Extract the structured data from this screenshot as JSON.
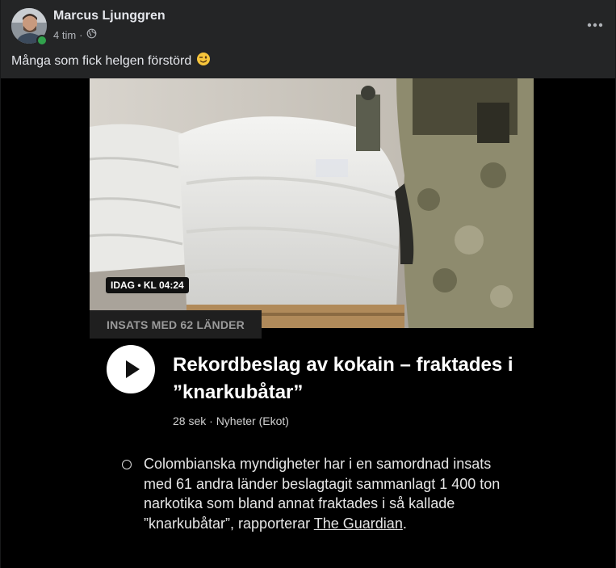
{
  "post": {
    "author": "Marcus Ljunggren",
    "time": "4 tim",
    "separator": "·",
    "privacy_icon": "globe-icon",
    "caption": "Många som fick helgen förstörd",
    "caption_emoji": "winking-face-icon",
    "more_icon": "more-options-icon"
  },
  "article": {
    "time_badge": "IDAG • KL 04:24",
    "category": "INSATS MED 62 LÄNDER",
    "headline": "Rekordbeslag av kokain – fraktades i ”knarkubåtar”",
    "meta": "28 sek · Nyheter (Ekot)",
    "body_prefix": "Colombianska myndigheter har i en samordnad insats med 61 andra länder beslagtagit sammanlagt 1 400 ton narkotika som bland annat fraktades i så kallade ”knarkubåtar”, rapporterar ",
    "body_link": "The Guardian",
    "body_suffix": "."
  },
  "colors": {
    "card_bg": "#242526",
    "page_bg": "#18191a",
    "online": "#31a24c"
  }
}
